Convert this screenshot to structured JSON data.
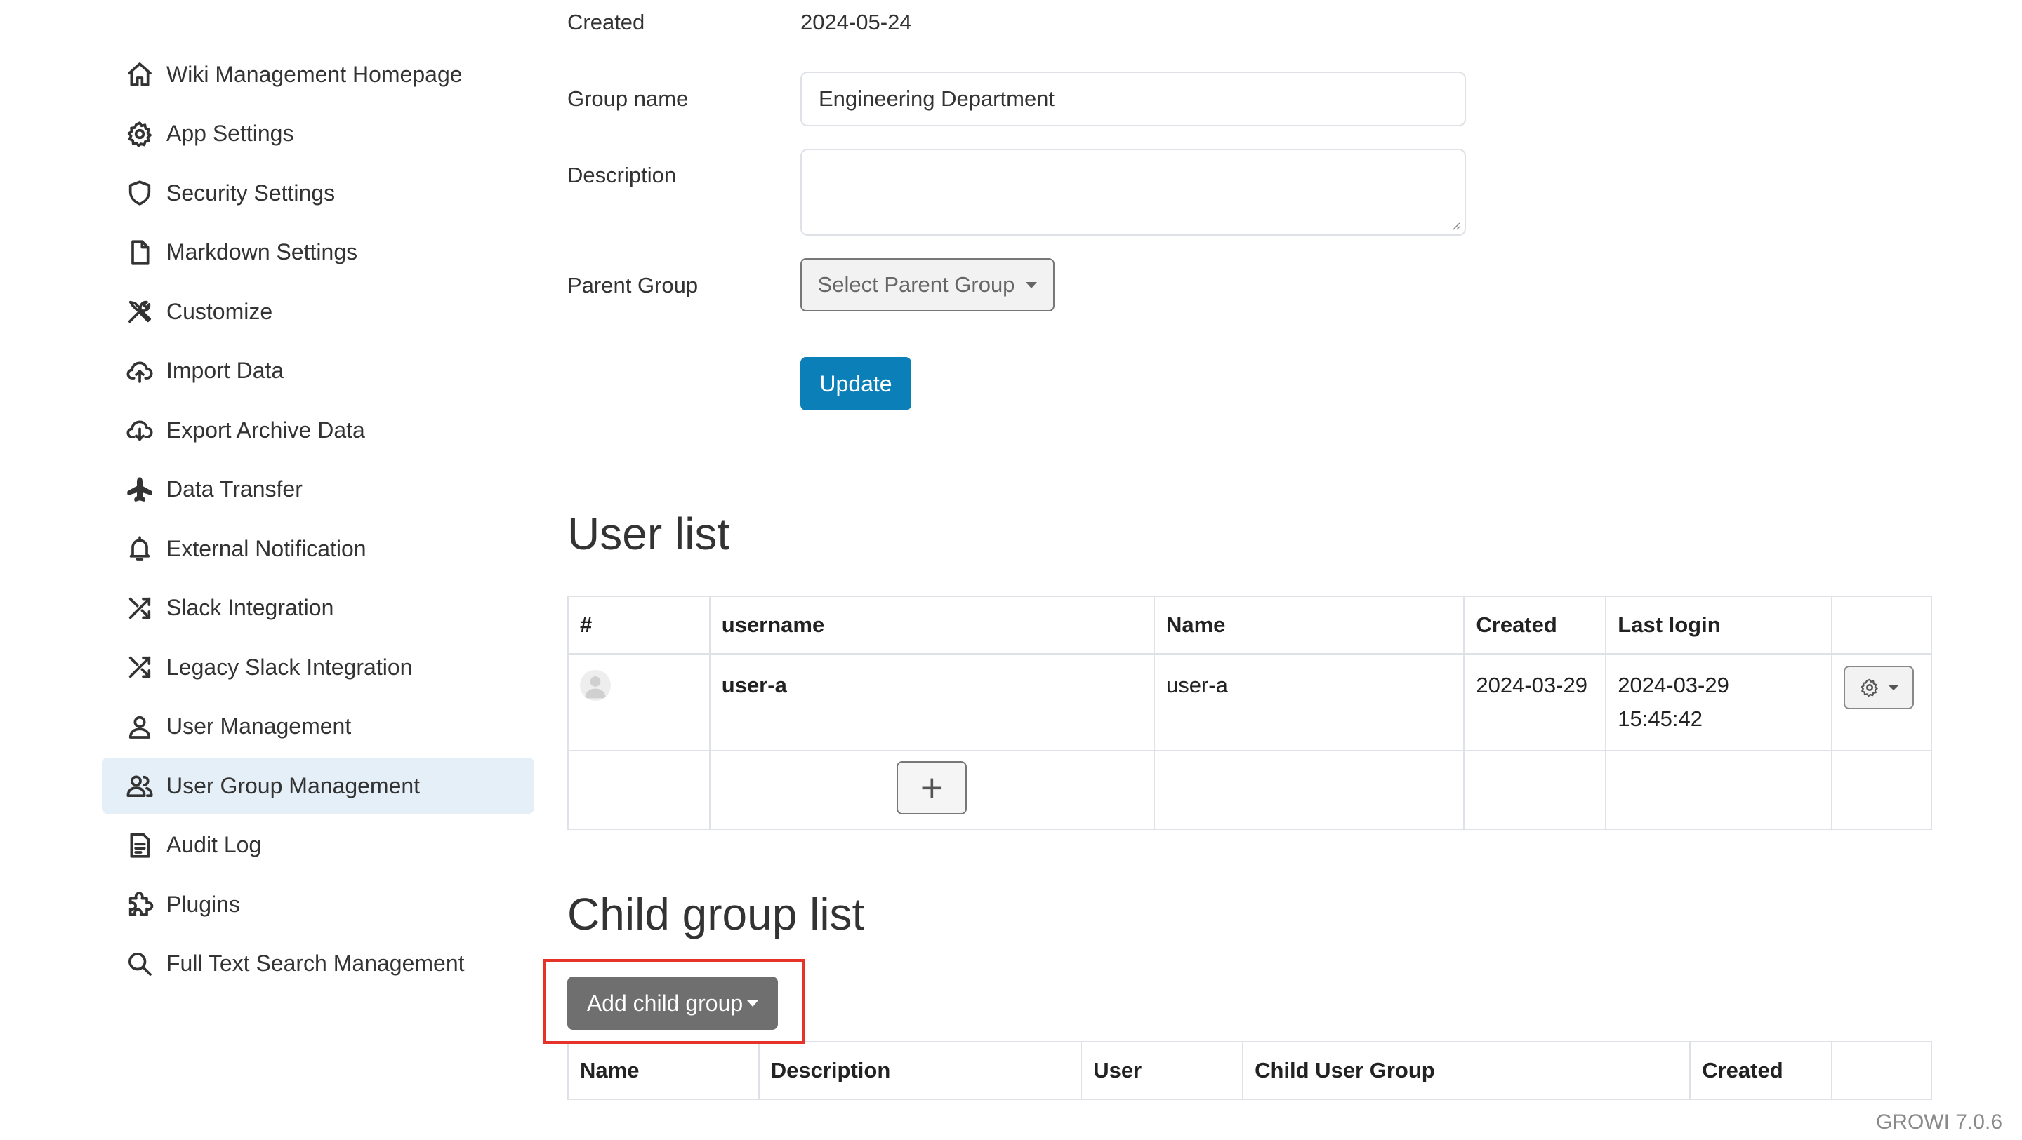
{
  "sidebar": {
    "items": [
      {
        "label": "Wiki Management Homepage",
        "icon": "home-icon"
      },
      {
        "label": "App Settings",
        "icon": "gear-icon"
      },
      {
        "label": "Security Settings",
        "icon": "shield-icon"
      },
      {
        "label": "Markdown Settings",
        "icon": "document-icon"
      },
      {
        "label": "Customize",
        "icon": "tools-icon"
      },
      {
        "label": "Import Data",
        "icon": "cloud-upload-icon"
      },
      {
        "label": "Export Archive Data",
        "icon": "cloud-download-icon"
      },
      {
        "label": "Data Transfer",
        "icon": "airplane-icon"
      },
      {
        "label": "External Notification",
        "icon": "bell-icon"
      },
      {
        "label": "Slack Integration",
        "icon": "shuffle-icon"
      },
      {
        "label": "Legacy Slack Integration",
        "icon": "shuffle-icon"
      },
      {
        "label": "User Management",
        "icon": "person-icon"
      },
      {
        "label": "User Group Management",
        "icon": "people-icon",
        "active": true
      },
      {
        "label": "Audit Log",
        "icon": "file-text-icon"
      },
      {
        "label": "Plugins",
        "icon": "puzzle-icon"
      },
      {
        "label": "Full Text Search Management",
        "icon": "search-icon"
      }
    ]
  },
  "form": {
    "created_label": "Created",
    "created_value": "2024-05-24",
    "group_name_label": "Group name",
    "group_name_value": "Engineering Department",
    "description_label": "Description",
    "description_value": "",
    "parent_group_label": "Parent Group",
    "parent_group_button": "Select Parent Group",
    "update_button": "Update"
  },
  "user_list": {
    "title": "User list",
    "columns": [
      "#",
      "username",
      "Name",
      "Created",
      "Last login",
      ""
    ],
    "rows": [
      {
        "username": "user-a",
        "name": "user-a",
        "created": "2024-03-29",
        "last_login": "2024-03-29 15:45:42"
      }
    ],
    "add_button": "+"
  },
  "child_group_list": {
    "title": "Child group list",
    "add_button": "Add child group",
    "columns": [
      "Name",
      "Description",
      "User",
      "Child User Group",
      "Created",
      ""
    ]
  },
  "footer": {
    "version": "GROWI 7.0.6"
  },
  "colors": {
    "primary": "#0b7fb8",
    "active_nav": "#e4eff7",
    "highlight": "#e5332a",
    "secondary_button": "#6f6f6f"
  }
}
